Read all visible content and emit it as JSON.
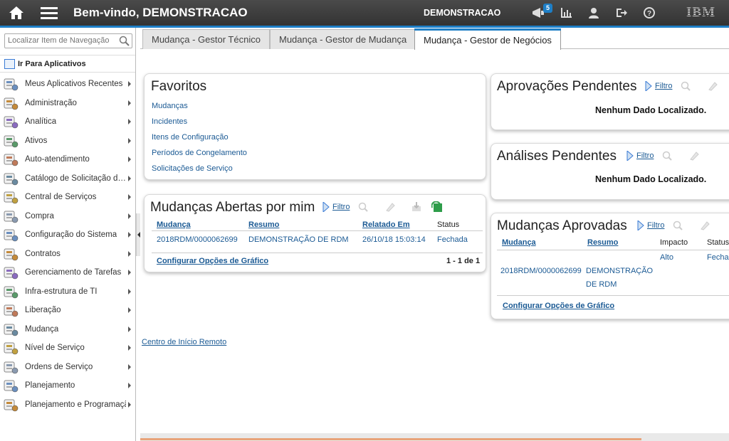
{
  "topbar": {
    "title": "Bem-vindo, DEMONSTRACAO",
    "user": "DEMONSTRACAO",
    "notification_count": "5",
    "brand": "IBM"
  },
  "sidebar": {
    "search_placeholder": "Localizar Item de Navegação",
    "apps_header": "Ir Para Aplicativos",
    "items": [
      {
        "label": "Meus Aplicativos Recentes",
        "icon": "recent-apps-icon"
      },
      {
        "label": "Administração",
        "icon": "administration-icon"
      },
      {
        "label": "Analítica",
        "icon": "analytics-icon"
      },
      {
        "label": "Ativos",
        "icon": "assets-icon"
      },
      {
        "label": "Auto-atendimento",
        "icon": "self-service-icon"
      },
      {
        "label": "Catálogo de Solicitação de Serviço",
        "icon": "service-catalog-icon"
      },
      {
        "label": "Central de Serviços",
        "icon": "service-desk-icon"
      },
      {
        "label": "Compra",
        "icon": "purchase-icon"
      },
      {
        "label": "Configuração do Sistema",
        "icon": "system-config-icon"
      },
      {
        "label": "Contratos",
        "icon": "contracts-icon"
      },
      {
        "label": "Gerenciamento de Tarefas",
        "icon": "task-management-icon"
      },
      {
        "label": "Infra-estrutura de TI",
        "icon": "it-infrastructure-icon"
      },
      {
        "label": "Liberação",
        "icon": "release-icon"
      },
      {
        "label": "Mudança",
        "icon": "change-icon"
      },
      {
        "label": "Nível de Serviço",
        "icon": "service-level-icon"
      },
      {
        "label": "Ordens de Serviço",
        "icon": "work-orders-icon"
      },
      {
        "label": "Planejamento",
        "icon": "planning-icon"
      },
      {
        "label": "Planejamento e Programação",
        "icon": "scheduling-icon"
      }
    ]
  },
  "tabs": [
    {
      "label": "Mudança - Gestor Técnico",
      "active": false
    },
    {
      "label": "Mudança - Gestor de Mudança",
      "active": false
    },
    {
      "label": "Mudança - Gestor de Negócios",
      "active": true
    }
  ],
  "favorites": {
    "title": "Favoritos",
    "links": [
      "Mudanças",
      "Incidentes",
      "Itens de Configuração",
      "Períodos de Congelamento",
      "Solicitações de Serviço"
    ]
  },
  "open_changes": {
    "title": "Mudanças Abertas por mim",
    "filter": "Filtro",
    "columns": [
      "Mudança",
      "Resumo",
      "Relatado Em",
      "Status"
    ],
    "rows": [
      {
        "change": "2018RDM/0000062699",
        "summary": "DEMONSTRAÇÃO DE RDM",
        "reported": "26/10/18 15:03:14",
        "status": "Fechada"
      }
    ],
    "config_link": "Configurar Opções de Gráfico",
    "pagination": "1 - 1 de 1"
  },
  "pending_approvals": {
    "title": "Aprovações Pendentes",
    "filter": "Filtro",
    "empty": "Nenhum Dado Localizado."
  },
  "pending_reviews": {
    "title": "Análises Pendentes",
    "filter": "Filtro",
    "empty": "Nenhum Dado Localizado."
  },
  "approved_changes": {
    "title": "Mudanças Aprovadas",
    "filter": "Filtro",
    "columns": [
      "Mudança",
      "Resumo",
      "Impacto",
      "Status"
    ],
    "rows": [
      {
        "change": "2018RDM/0000062699",
        "summary_line1": "DEMONSTRAÇÃO",
        "summary_line2": "DE RDM",
        "impact": "Alto",
        "status": "Fecha"
      }
    ],
    "config_link": "Configurar Opções de Gráfico"
  },
  "remote_link": "Centro de Início Remoto",
  "colors": {
    "accent": "#1e7fc7",
    "link": "#1b5a94",
    "topbar": "#3c3c3c"
  }
}
